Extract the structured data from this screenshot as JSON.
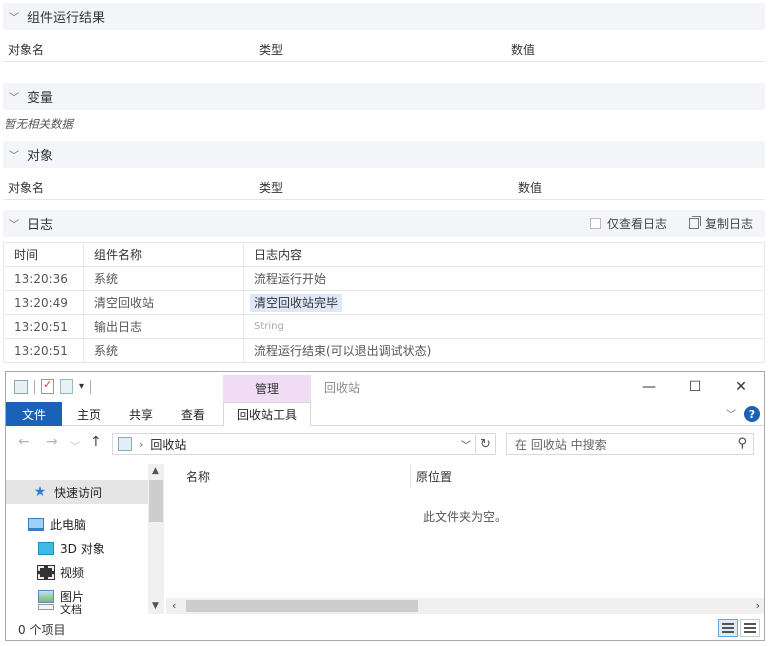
{
  "panel": {
    "run_results": {
      "title": "组件运行结果",
      "columns": [
        "对象名",
        "类型",
        "数值"
      ]
    },
    "variables": {
      "title": "变量",
      "empty_text": "暂无相关数据"
    },
    "objects": {
      "title": "对象",
      "columns": [
        "对象名",
        "类型",
        "数值"
      ]
    },
    "log": {
      "title": "日志",
      "only_view_label": "仅查看日志",
      "copy_label": "复制日志",
      "columns": [
        "时间",
        "组件名称",
        "日志内容"
      ],
      "rows": [
        {
          "time": "13:20:36",
          "component": "系统",
          "content": "流程运行开始"
        },
        {
          "time": "13:20:49",
          "component": "清空回收站",
          "content": "清空回收站完毕"
        },
        {
          "time": "13:20:51",
          "component": "输出日志",
          "content": "String"
        },
        {
          "time": "13:20:51",
          "component": "系统",
          "content": "流程运行结束(可以退出调试状态)"
        }
      ]
    }
  },
  "explorer": {
    "manage_tab": "管理",
    "window_title": "回收站",
    "controls": {
      "minimize": "—",
      "maximize": "☐",
      "close": "✕"
    },
    "ribbon_tabs": [
      "文件",
      "主页",
      "共享",
      "查看"
    ],
    "tools_tab": "回收站工具",
    "help": "?",
    "address": {
      "path": "回收站"
    },
    "search_placeholder": "在 回收站 中搜索",
    "nav": {
      "quick_access": "快速访问",
      "this_pc": "此电脑",
      "objects_3d": "3D 对象",
      "videos": "视频",
      "pictures": "图片",
      "documents": "文档"
    },
    "columns": {
      "name": "名称",
      "original_location": "原位置"
    },
    "empty_message": "此文件夹为空。",
    "status": "0 个项目",
    "icons": {
      "back": "arrow-left-icon",
      "forward": "arrow-right-icon",
      "up": "arrow-up-icon",
      "refresh": "refresh-icon",
      "search": "search-icon"
    }
  }
}
